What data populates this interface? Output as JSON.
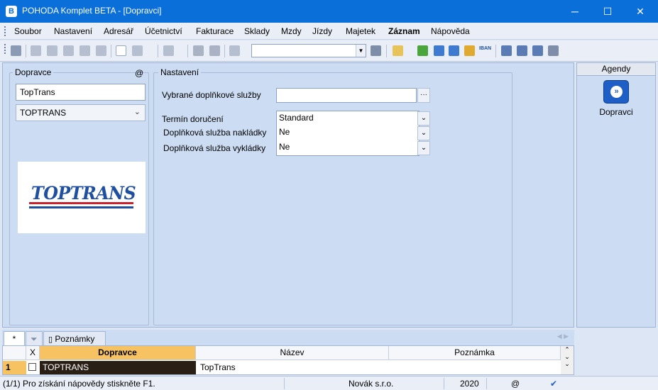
{
  "window": {
    "title": "POHODA Komplet BETA - [Dopravci]",
    "app_icon": "B",
    "minimize": "─",
    "maximize": "☐",
    "close": "✕"
  },
  "menu": [
    "Soubor",
    "Nastavení",
    "Adresář",
    "Účetnictví",
    "Fakturace",
    "Sklady",
    "Mzdy",
    "Jízdy",
    "Majetek",
    "Záznam",
    "Nápověda"
  ],
  "toolbar": {
    "iban_label": "IBAN"
  },
  "carrier_panel": {
    "legend": "Dopravce",
    "at_symbol": "@",
    "name_value": "TopTrans",
    "carrier_select": "TOPTRANS",
    "logo_text": "TOPTRANS"
  },
  "settings_panel": {
    "legend": "Nastavení",
    "extra_services_label": "Vybrané doplňkové služby",
    "extra_services_value": "",
    "ellipsis": "···",
    "delivery_label": "Termín doručení",
    "delivery_value": "Standard",
    "loading_label": "Doplňková služba nakládky",
    "loading_value": "Ne",
    "unloading_label": "Doplňková služba vykládky",
    "unloading_value": "Ne"
  },
  "sidebar": {
    "header": "Agendy",
    "item_label": "Dopravci"
  },
  "tabs": {
    "asterisk": "*",
    "notes": "Poznámky"
  },
  "grid": {
    "columns": {
      "x": "X",
      "carrier": "Dopravce",
      "name": "Název",
      "note": "Poznámka"
    },
    "rows": [
      {
        "num": "1",
        "carrier": "TOPTRANS",
        "name": "TopTrans",
        "note": ""
      }
    ]
  },
  "status": {
    "help": "(1/1) Pro získání nápovědy stiskněte F1.",
    "company": "Novák s.r.o.",
    "year": "2020",
    "at": "@"
  }
}
